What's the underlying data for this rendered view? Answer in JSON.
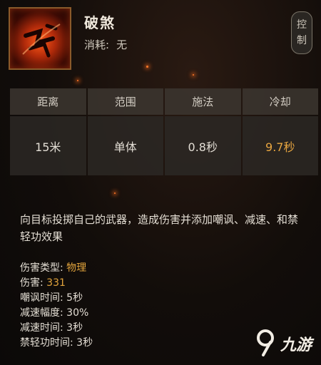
{
  "skill": {
    "name": "破煞",
    "cost_label": "消耗:",
    "cost_value": "无",
    "control_badge": [
      "控",
      "制"
    ]
  },
  "stats": {
    "headers": [
      "距离",
      "范围",
      "施法",
      "冷却"
    ],
    "values": [
      "15米",
      "单体",
      "0.8秒",
      "9.7秒"
    ]
  },
  "description": "向目标投掷自己的武器，造成伤害并添加嘲讽、减速、和禁轻功效果",
  "properties": [
    {
      "label": "伤害类型:",
      "value": "物理",
      "accent": true
    },
    {
      "label": "伤害:",
      "value": "331",
      "accent": true
    },
    {
      "label": "嘲讽时间:",
      "value": "5秒",
      "accent": false
    },
    {
      "label": "减速幅度:",
      "value": "30%",
      "accent": false
    },
    {
      "label": "减速时间:",
      "value": "3秒",
      "accent": false
    },
    {
      "label": "禁轻功时间:",
      "value": "3秒",
      "accent": false
    }
  ],
  "watermark": {
    "text": "九游"
  },
  "colors": {
    "accent": "#e2a43c",
    "cooldown": "#e8a640",
    "background": "#120d0a"
  },
  "icons": {
    "skill": "skill-emblem-icon",
    "watermark": "nine-game-logo-icon"
  }
}
